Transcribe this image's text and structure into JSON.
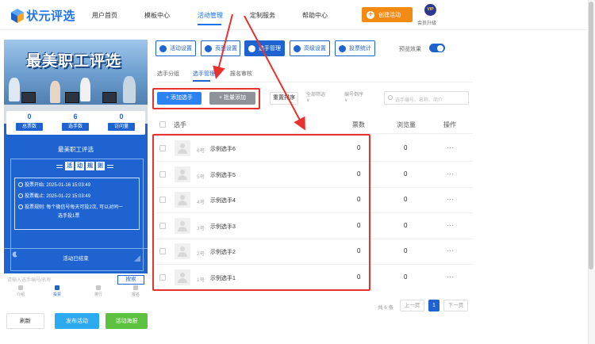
{
  "logo": {
    "text": "状元评选"
  },
  "nav": {
    "items": [
      "用户首页",
      "模板中心",
      "活动管理",
      "定制服务",
      "帮助中心"
    ],
    "create_label": "创建活动",
    "vip_badge": "VIP",
    "vip_label": "会员升级"
  },
  "preview": {
    "banner_title": "最美职工评选",
    "stats": [
      {
        "value": "0",
        "label": "总票数"
      },
      {
        "value": "6",
        "label": "选手数"
      },
      {
        "value": "0",
        "label": "访问量"
      }
    ],
    "activity_title": "最美职工评选",
    "rules_heading": [
      "活",
      "动",
      "规",
      "则"
    ],
    "rules": [
      "投票开始: 2025-01-16 15:03:49",
      "投票截止: 2025-01-22 15:03:49",
      "投票规则: 每个微信号每天可投2次, 可以对同一",
      "选手投1票"
    ],
    "ended_label": "活动已结束",
    "search_placeholder": "请输入选手编号/名称",
    "search_button": "搜索",
    "tabs": [
      "介绍",
      "投票",
      "排行",
      "报名"
    ]
  },
  "bottom_buttons": {
    "refresh": "刷新",
    "publish": "发布活动",
    "poster": "活动海报"
  },
  "toolbar": {
    "buttons": [
      "活动设置",
      "页面设置",
      "选手管理",
      "高级设置",
      "投票统计"
    ],
    "preview_label": "预览效果",
    "preview_enabled": true
  },
  "subtabs": [
    "选手分组",
    "选手管理",
    "报名审核"
  ],
  "actions": {
    "add": "+ 添加选手",
    "batch": "+ 批量添加",
    "reset": "重置排序",
    "filter_all": [
      "全部筛选",
      "∨"
    ],
    "sort_by_number": [
      "编号倒序",
      "∨"
    ],
    "search_placeholder": "选手编号、名称、简介"
  },
  "table": {
    "headers": [
      "选手",
      "票数",
      "浏览量",
      "操作"
    ],
    "rows": [
      {
        "number": "6号",
        "name": "示例选手6",
        "votes": "0",
        "views": "0",
        "ops": "···"
      },
      {
        "number": "5号",
        "name": "示例选手5",
        "votes": "0",
        "views": "0",
        "ops": "···"
      },
      {
        "number": "4号",
        "name": "示例选手4",
        "votes": "0",
        "views": "0",
        "ops": "···"
      },
      {
        "number": "3号",
        "name": "示例选手3",
        "votes": "0",
        "views": "0",
        "ops": "···"
      },
      {
        "number": "2号",
        "name": "示例选手2",
        "votes": "0",
        "views": "0",
        "ops": "···"
      },
      {
        "number": "1号",
        "name": "示例选手1",
        "votes": "0",
        "views": "0",
        "ops": "···"
      }
    ]
  },
  "pagination": {
    "total": "共 6 条",
    "prev": "上一页",
    "current": "1",
    "next": "下一页"
  },
  "colors": {
    "primary": "#1e63cf",
    "orange": "#f38a12",
    "annotation_red": "#e8322e",
    "green": "#5cc23f"
  }
}
